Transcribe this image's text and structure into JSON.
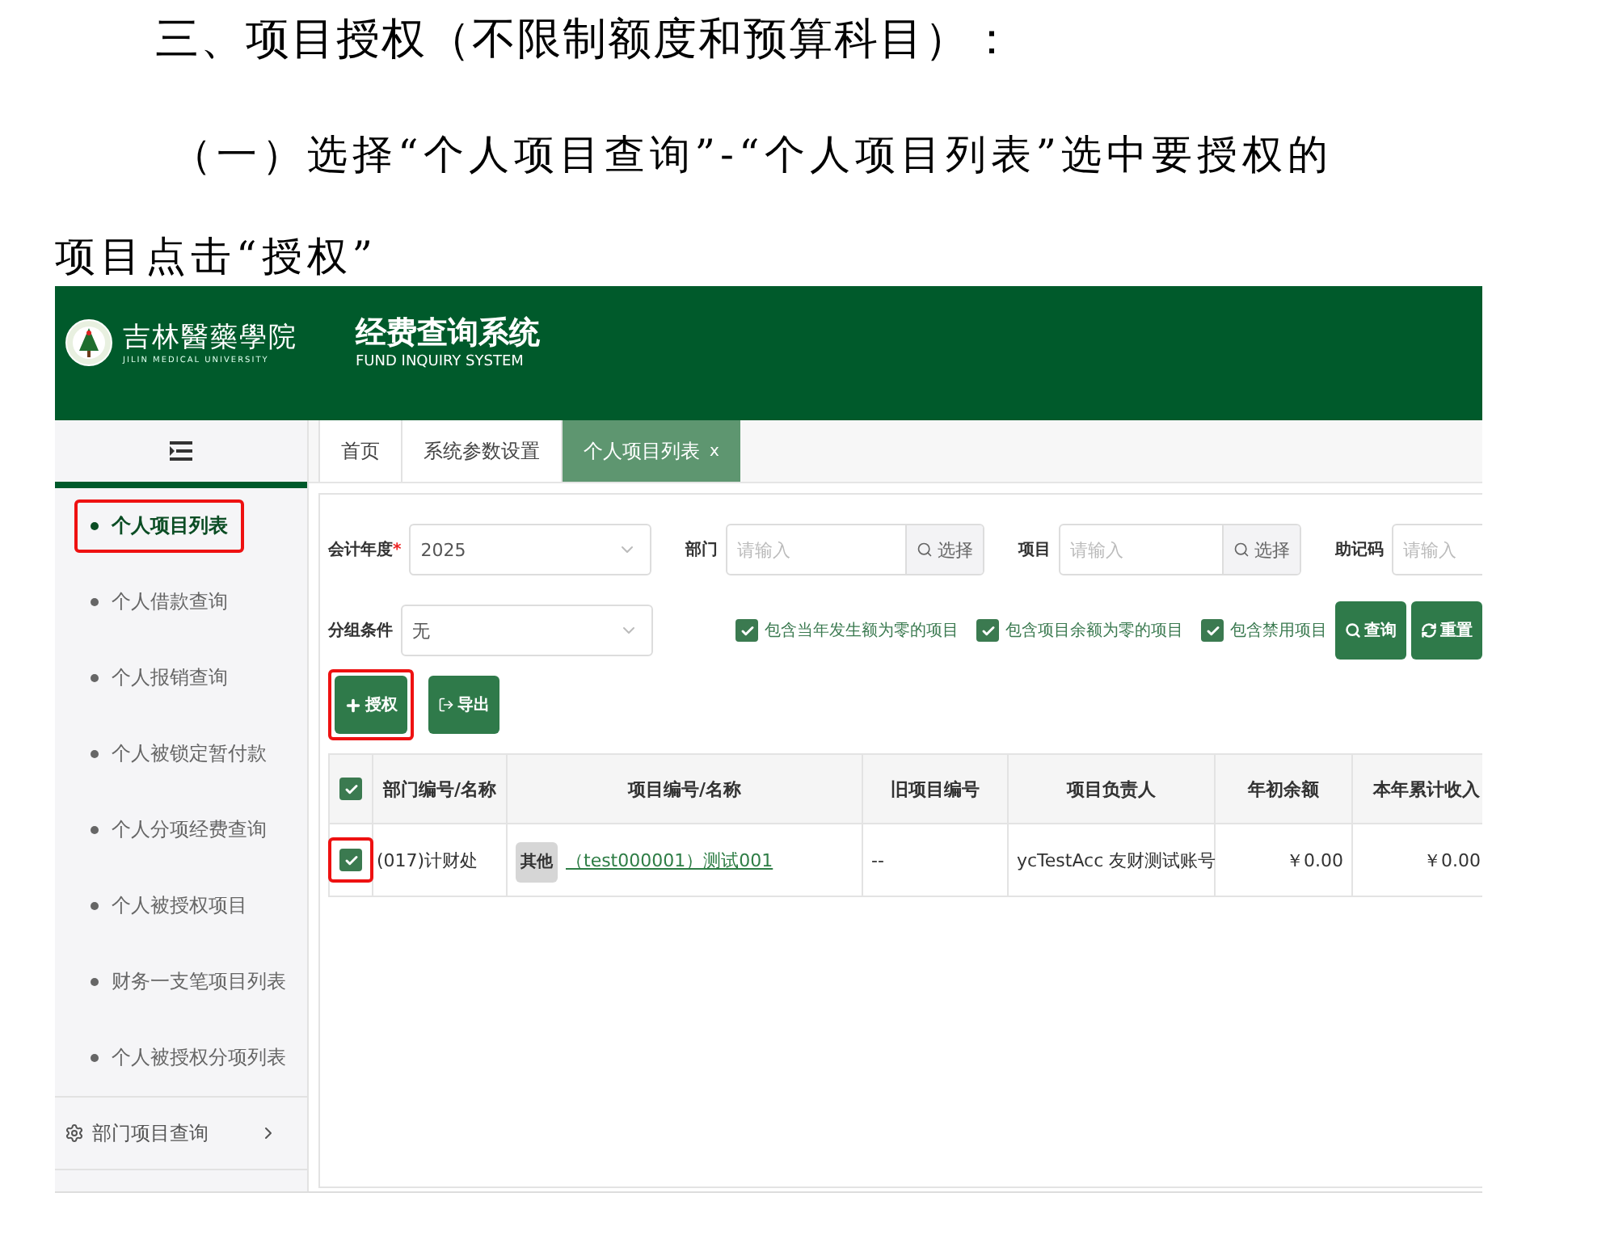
{
  "document": {
    "heading": "三、项目授权（不限制额度和预算科目）：",
    "paragraph": "（一）选择“个人项目查询”-“个人项目列表”选中要授权的项目点击“授权”"
  },
  "app": {
    "logo": {
      "name": "吉林醫藥學院",
      "subtitle": "JILIN MEDICAL UNIVERSITY"
    },
    "system_title": "经费查询系统",
    "system_subtitle": "FUND INQUIRY SYSTEM",
    "sidebar": {
      "items": [
        {
          "label": "个人项目列表",
          "selected": true,
          "highlighted": true
        },
        {
          "label": "个人借款查询",
          "selected": false,
          "highlighted": false
        },
        {
          "label": "个人报销查询",
          "selected": false,
          "highlighted": false
        },
        {
          "label": "个人被锁定暂付款",
          "selected": false,
          "highlighted": false
        },
        {
          "label": "个人分项经费查询",
          "selected": false,
          "highlighted": false
        },
        {
          "label": "个人被授权项目",
          "selected": false,
          "highlighted": false
        },
        {
          "label": "财务一支笔项目列表",
          "selected": false,
          "highlighted": false
        },
        {
          "label": "个人被授权分项列表",
          "selected": false,
          "highlighted": false
        }
      ],
      "group": {
        "label": "部门项目查询",
        "expanded": false
      }
    },
    "tabs": [
      {
        "label": "首页",
        "selected": false
      },
      {
        "label": "系统参数设置",
        "selected": false
      },
      {
        "label": "个人项目列表",
        "selected": true,
        "close": "x"
      }
    ],
    "filters": [
      {
        "label": "会计年度",
        "required_mark": "*",
        "kind": "select",
        "value": "2025"
      },
      {
        "label": "部门",
        "kind": "picker",
        "placeholder": "请输入",
        "button": "选择"
      },
      {
        "label": "项目",
        "kind": "picker",
        "placeholder": "请输入",
        "button": "选择"
      },
      {
        "label": "助记码",
        "kind": "input",
        "placeholder": "请输入"
      }
    ],
    "group_filter": {
      "label": "分组条件",
      "value": "无"
    },
    "options": [
      {
        "label": "包含当年发生额为零的项目",
        "checked": true
      },
      {
        "label": "包含项目余额为零的项目",
        "checked": true
      },
      {
        "label": "包含禁用项目",
        "checked": true
      }
    ],
    "search_buttons": [
      {
        "label": "查询"
      },
      {
        "label": "重置"
      }
    ],
    "actions": [
      {
        "label": "授权",
        "kind": "authorize",
        "highlighted": true
      },
      {
        "label": "导出",
        "kind": "export",
        "highlighted": false
      }
    ],
    "table": {
      "select_all": true,
      "columns": [
        "部门编号/名称",
        "项目编号/名称",
        "旧项目编号",
        "项目负责人",
        "年初余额",
        "本年累计收入"
      ],
      "rows": [
        {
          "selected": true,
          "highlighted": true,
          "dept": "(017)计财处",
          "tag": "其他",
          "project": "（test000001）测试001",
          "old": "--",
          "owner": "ycTestAcc 友财测试账号",
          "opening": "￥0.00",
          "income": "￥0.00"
        }
      ]
    }
  }
}
